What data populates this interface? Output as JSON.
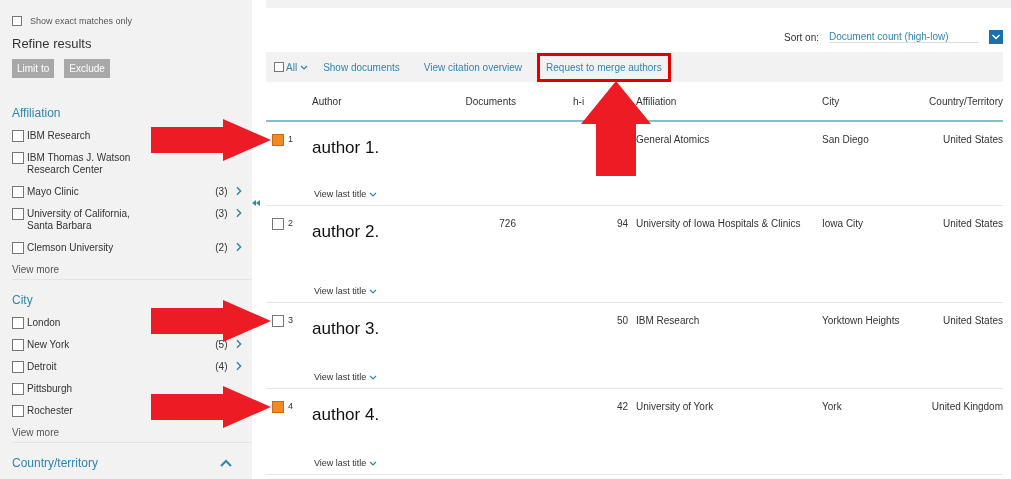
{
  "sidebar": {
    "exact_matches": {
      "label": "Show exact matches only",
      "checked": false
    },
    "refine_title": "Refine results",
    "buttons": [
      "Limit to",
      "Exclude"
    ],
    "facets": [
      {
        "title": "Affiliation",
        "items": [
          {
            "label": "IBM Research",
            "checked": false
          },
          {
            "label": "IBM Thomas J. Watson Research Center",
            "checked": false
          },
          {
            "label": "Mayo Clinic",
            "checked": false,
            "count": "(3)"
          },
          {
            "label": "University of California, Santa Barbara",
            "checked": false,
            "count": "(3)"
          },
          {
            "label": "Clemson University",
            "checked": false,
            "count": "(2)"
          }
        ],
        "view_more": "View more"
      },
      {
        "title": "City",
        "items": [
          {
            "label": "London",
            "checked": false
          },
          {
            "label": "New York",
            "checked": false,
            "count": "(5)"
          },
          {
            "label": "Detroit",
            "checked": false,
            "count": "(4)"
          },
          {
            "label": "Pittsburgh",
            "checked": false
          },
          {
            "label": "Rochester",
            "checked": false
          }
        ],
        "view_more": "View more"
      },
      {
        "title": "Country/territory",
        "expanded": true
      }
    ]
  },
  "sort": {
    "label": "Sort on:",
    "value": "Document count (high-low)"
  },
  "toolbar": {
    "select_all": {
      "label": "All",
      "checked": false
    },
    "actions": [
      {
        "label": "Show documents",
        "highlighted": false
      },
      {
        "label": "View citation overview",
        "highlighted": false
      },
      {
        "label": "Request to merge authors",
        "highlighted": true
      }
    ]
  },
  "columns": [
    "Author",
    "Documents",
    "h-i",
    "Affiliation",
    "City",
    "Country/Territory"
  ],
  "rows": [
    {
      "number": "1",
      "checked": true,
      "pointer": true,
      "author": "author 1.",
      "affiliation": "General Atomics",
      "city": "San Diego",
      "country": "United States",
      "view_last": "View last title"
    },
    {
      "number": "2",
      "checked": false,
      "pointer": false,
      "author": "author 2.",
      "documents": "726",
      "h_index": "94",
      "affiliation": "University of Iowa Hospitals & Clinics",
      "city": "Iowa City",
      "country": "United States",
      "view_last": "View last title"
    },
    {
      "number": "3",
      "checked": false,
      "pointer": true,
      "author": "author 3.",
      "h_index": "50",
      "affiliation": "IBM Research",
      "city": "Yorktown Heights",
      "country": "United States",
      "view_last": "View last title"
    },
    {
      "number": "4",
      "checked": true,
      "pointer": true,
      "author": "author 4.",
      "h_index": "42",
      "affiliation": "University of York",
      "city": "York",
      "country": "United Kingdom",
      "view_last": "View last title"
    }
  ]
}
